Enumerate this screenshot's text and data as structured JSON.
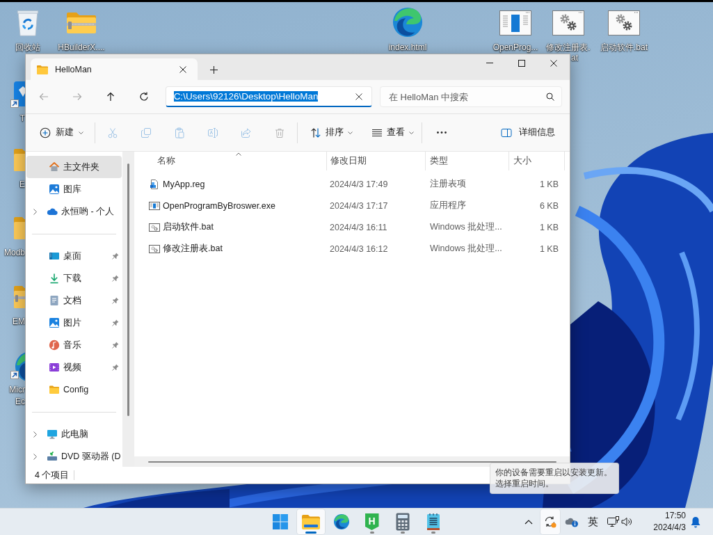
{
  "desktop": {
    "icons": [
      {
        "kind": "recycle",
        "label": "回收站",
        "shortcut": false
      },
      {
        "kind": "zip",
        "label": "HBuilderX....",
        "shortcut": false
      },
      {
        "kind": "edge",
        "label": "index.html",
        "shortcut": false
      },
      {
        "kind": "exe",
        "label": "OpenProg...",
        "shortcut": false
      },
      {
        "kind": "bat",
        "label": "修改注册表.",
        "label_line2": "at",
        "shortcut": false
      },
      {
        "kind": "bat",
        "label": "启动软件.bat",
        "shortcut": false
      }
    ],
    "partial_icons": [
      {
        "kind": "app",
        "label": "T",
        "shortcut": true
      },
      {
        "kind": "folder",
        "label": "E",
        "shortcut": false
      },
      {
        "kind": "folder",
        "label": "Modb",
        "shortcut": false
      },
      {
        "kind": "zip",
        "label": "EM",
        "shortcut": false
      },
      {
        "kind": "edge",
        "label": "Micr",
        "label_line2": "Ec",
        "shortcut": true
      }
    ]
  },
  "explorer": {
    "tabs": [
      {
        "title": "HelloMan",
        "selected": true
      }
    ],
    "nav": [
      {
        "kind": "back",
        "disabled": true
      },
      {
        "kind": "forward",
        "disabled": true
      },
      {
        "kind": "up",
        "disabled": false
      },
      {
        "kind": "refresh",
        "disabled": false
      }
    ],
    "address": {
      "value": "C:\\Users\\92126\\Desktop\\HelloMan",
      "selected": true
    },
    "search": {
      "placeholder": "在 HelloMan 中搜索"
    },
    "command_groups": [
      [
        {
          "kind": "new",
          "label": "新建",
          "dropdown": true,
          "disabled": false
        }
      ],
      [
        {
          "kind": "cut",
          "disabled": true
        },
        {
          "kind": "copy",
          "disabled": true
        },
        {
          "kind": "paste",
          "disabled": true
        },
        {
          "kind": "rename",
          "disabled": true
        },
        {
          "kind": "share",
          "disabled": true
        },
        {
          "kind": "delete",
          "disabled": true
        }
      ],
      [
        {
          "kind": "sort",
          "label": "排序",
          "dropdown": true,
          "disabled": false
        },
        {
          "kind": "view",
          "label": "查看",
          "dropdown": true,
          "disabled": false
        }
      ],
      [
        {
          "kind": "more",
          "disabled": false
        }
      ]
    ],
    "details_button": {
      "label": "详细信息"
    },
    "sidebar": [
      [
        {
          "kind": "home",
          "label": "主文件夹",
          "selected": true,
          "expandable": false,
          "pinned": false
        },
        {
          "kind": "gallery",
          "label": "图库",
          "selected": false,
          "expandable": false,
          "pinned": false
        },
        {
          "kind": "cloud",
          "label": "永恒哟 - 个人",
          "selected": false,
          "expandable": true,
          "pinned": false
        }
      ],
      [
        {
          "kind": "desktop",
          "label": "桌面",
          "selected": false,
          "expandable": false,
          "pinned": true
        },
        {
          "kind": "downloads",
          "label": "下载",
          "selected": false,
          "expandable": false,
          "pinned": true
        },
        {
          "kind": "documents",
          "label": "文档",
          "selected": false,
          "expandable": false,
          "pinned": true
        },
        {
          "kind": "pictures",
          "label": "图片",
          "selected": false,
          "expandable": false,
          "pinned": true
        },
        {
          "kind": "music",
          "label": "音乐",
          "selected": false,
          "expandable": false,
          "pinned": true
        },
        {
          "kind": "videos",
          "label": "视频",
          "selected": false,
          "expandable": false,
          "pinned": true
        },
        {
          "kind": "folder",
          "label": "Config",
          "selected": false,
          "expandable": false,
          "pinned": false
        }
      ],
      [
        {
          "kind": "pc",
          "label": "此电脑",
          "selected": false,
          "expandable": true,
          "pinned": false
        },
        {
          "kind": "dvd",
          "label": "DVD 驱动器 (D",
          "selected": false,
          "expandable": true,
          "pinned": false
        }
      ]
    ],
    "columns": [
      {
        "label": "名称",
        "sorted": true
      },
      {
        "label": "修改日期",
        "sorted": false
      },
      {
        "label": "类型",
        "sorted": false
      },
      {
        "label": "大小",
        "sorted": false
      }
    ],
    "files": [
      {
        "kind": "reg",
        "name": "MyApp.reg",
        "modified": "2024/4/3 17:49",
        "type": "注册表项",
        "size": "1 KB"
      },
      {
        "kind": "exe",
        "name": "OpenProgramByBroswer.exe",
        "modified": "2024/4/3 17:17",
        "type": "应用程序",
        "size": "6 KB"
      },
      {
        "kind": "bat",
        "name": "启动软件.bat",
        "modified": "2024/4/3 16:11",
        "type": "Windows 批处理...",
        "size": "1 KB"
      },
      {
        "kind": "bat",
        "name": "修改注册表.bat",
        "modified": "2024/4/3 16:12",
        "type": "Windows 批处理...",
        "size": "1 KB"
      }
    ],
    "status_bar": {
      "item_count": "4 个项目"
    }
  },
  "notification": {
    "lines": [
      "你的设备需要重启以安装更新。",
      "选择重启时间。"
    ]
  },
  "taskbar": {
    "apps": [
      {
        "kind": "start",
        "active": false,
        "running": false
      },
      {
        "kind": "explorer",
        "active": true,
        "running": true
      },
      {
        "kind": "edge",
        "active": false,
        "running": false
      },
      {
        "kind": "hbuilder",
        "glyph": "H",
        "active": false,
        "running": true
      },
      {
        "kind": "calculator",
        "active": false,
        "running": true
      },
      {
        "kind": "notepad",
        "active": false,
        "running": true
      }
    ],
    "tray": [
      {
        "kind": "overflow",
        "highlighted": false
      },
      {
        "kind": "update",
        "highlighted": true
      },
      {
        "kind": "onedrive",
        "highlighted": false
      },
      {
        "kind": "ime",
        "label": "英",
        "highlighted": false
      },
      {
        "kind": "network",
        "highlighted": false
      },
      {
        "kind": "volume",
        "highlighted": false
      },
      {
        "kind": "clock",
        "time": "17:50",
        "date": "2024/4/3",
        "highlighted": false
      },
      {
        "kind": "notifications",
        "highlighted": false
      }
    ]
  }
}
